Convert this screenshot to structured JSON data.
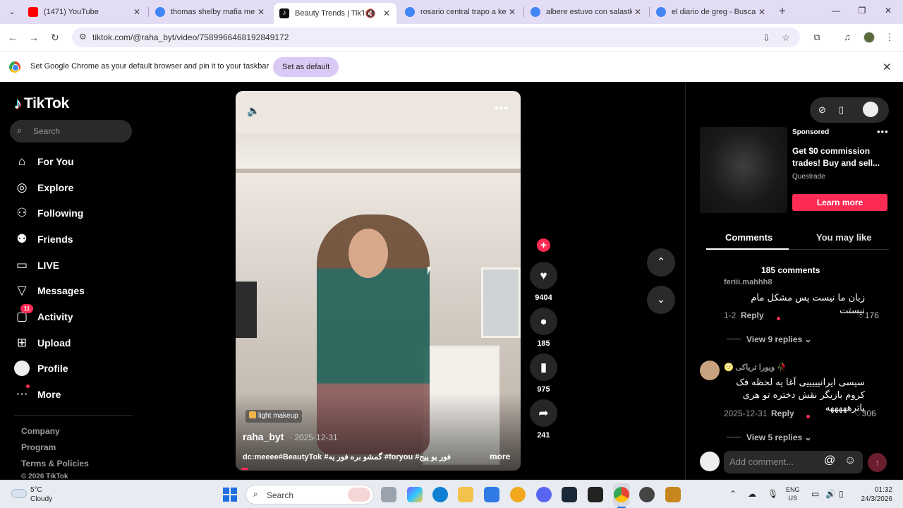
{
  "browser": {
    "tabs": [
      {
        "title": "(1471) YouTube",
        "favicon_color": "#ff0000",
        "active": false,
        "muted": false
      },
      {
        "title": "thomas shelby mafia mem",
        "favicon_color": "#4285f4",
        "active": false,
        "muted": false
      },
      {
        "title": "Beauty Trends | TikTok",
        "favicon_color": "#111111",
        "active": true,
        "muted": true
      },
      {
        "title": "rosario central trapo a key",
        "favicon_color": "#4285f4",
        "active": false,
        "muted": false
      },
      {
        "title": "albere estuvo con salastk",
        "favicon_color": "#4285f4",
        "active": false,
        "muted": false
      },
      {
        "title": "el diario de greg - Buscar c",
        "favicon_color": "#4285f4",
        "active": false,
        "muted": false
      }
    ],
    "url": "tiktok.com/@raha_byt/video/7589966468192849172",
    "infobar": {
      "message": "Set Google Chrome as your default browser and pin it to your taskbar",
      "button": "Set as default"
    }
  },
  "tiktok": {
    "logo_text": "TikTok",
    "search_placeholder": "Search",
    "nav": [
      {
        "label": "For You",
        "icon": "home-icon"
      },
      {
        "label": "Explore",
        "icon": "compass-icon"
      },
      {
        "label": "Following",
        "icon": "user-follow-icon"
      },
      {
        "label": "Friends",
        "icon": "friends-icon"
      },
      {
        "label": "LIVE",
        "icon": "live-icon"
      },
      {
        "label": "Messages",
        "icon": "paper-plane-icon"
      },
      {
        "label": "Activity",
        "icon": "inbox-icon",
        "badge": "11"
      },
      {
        "label": "Upload",
        "icon": "plus-square-icon"
      },
      {
        "label": "Profile",
        "icon": "avatar"
      },
      {
        "label": "More",
        "icon": "ellipsis-icon"
      }
    ],
    "footer_links": [
      "Company",
      "Program",
      "Terms & Policies",
      "© 2026 TikTok"
    ],
    "video": {
      "tag": "light makeup",
      "author": "raha_byt",
      "date": "· 2025-12-31",
      "caption": "dc:meeee#BeautyTok #گمشو بره فور یه #foryou #فور یو پیج",
      "more": "more"
    },
    "actions": {
      "likes": "9404",
      "comments": "185",
      "saves": "975",
      "shares": "241"
    },
    "ad": {
      "sponsored": "Sponsored",
      "title": "Get $0 commission trades! Buy and sell...",
      "brand": "Questrade",
      "cta": "Learn more"
    },
    "tabs": {
      "comments": "Comments",
      "you_may_like": "You may like"
    },
    "comment_count": "185 comments",
    "comments": [
      {
        "user": "feriii.mahhh8",
        "text": "زبان ما نیست پس مشکل مام نیستت",
        "date": "1-2",
        "reply": "Reply",
        "likes": "176",
        "view_replies": "View 9 replies"
      },
      {
        "user": "🌝 ویورا تریاکی 🥀",
        "text": "سیسی ایرانیییییی آغا یه لحظه فک کروم بازیگر نقش دختره تو هری پاترهههههه",
        "date": "2025-12-31",
        "reply": "Reply",
        "likes": "306",
        "view_replies": "View 5 replies"
      }
    ],
    "add_comment_placeholder": "Add comment..."
  },
  "taskbar": {
    "weather_temp": "5°C",
    "weather_desc": "Cloudy",
    "search_placeholder": "Search",
    "lang_1": "ENG",
    "lang_2": "US",
    "time": "01:32",
    "date": "24/3/2026"
  }
}
